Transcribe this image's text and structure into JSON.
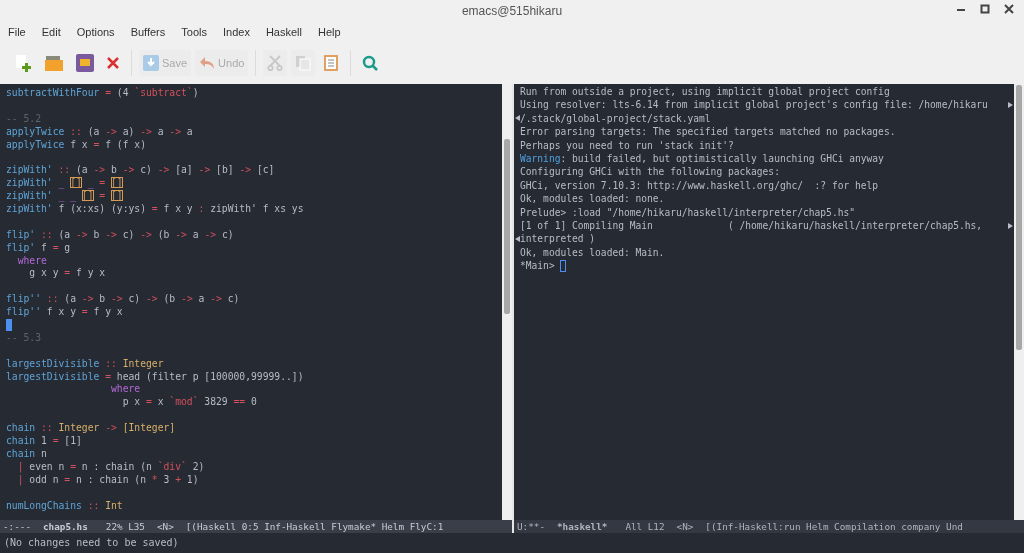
{
  "window": {
    "title": "emacs@515hikaru"
  },
  "menu": [
    "File",
    "Edit",
    "Options",
    "Buffers",
    "Tools",
    "Index",
    "Haskell",
    "Help"
  ],
  "toolbar": [
    {
      "disabled": false
    },
    {
      "disabled": false
    },
    {
      "disabled": false
    },
    {
      "disabled": false
    },
    {
      "label": "Save",
      "disabled": true
    },
    {
      "label": "Undo",
      "disabled": true
    },
    {
      "disabled": true
    },
    {
      "disabled": true
    },
    {
      "disabled": false
    },
    {
      "disabled": false
    }
  ],
  "editor": {
    "lines": [
      {
        "kind": "code",
        "tokens": [
          {
            "kind": "fn",
            "text": "subtractWithFour"
          },
          {
            "kind": "op",
            "text": " = "
          },
          {
            "kind": "plain",
            "text": "(4 "
          },
          {
            "kind": "op",
            "text": "`subtract`"
          },
          {
            "kind": "plain",
            "text": ")"
          }
        ]
      },
      {
        "kind": "blank"
      },
      {
        "kind": "code",
        "tokens": [
          {
            "kind": "comment",
            "text": "-- 5.2"
          }
        ]
      },
      {
        "kind": "code",
        "tokens": [
          {
            "kind": "fn",
            "text": "applyTwice"
          },
          {
            "kind": "op",
            "text": " :: "
          },
          {
            "kind": "plain",
            "text": "(a "
          },
          {
            "kind": "op",
            "text": "->"
          },
          {
            "kind": "plain",
            "text": " a) "
          },
          {
            "kind": "op",
            "text": "->"
          },
          {
            "kind": "plain",
            "text": " a "
          },
          {
            "kind": "op",
            "text": "->"
          },
          {
            "kind": "plain",
            "text": " a"
          }
        ]
      },
      {
        "kind": "code",
        "tokens": [
          {
            "kind": "fn",
            "text": "applyTwice"
          },
          {
            "kind": "plain",
            "text": " f x "
          },
          {
            "kind": "op",
            "text": "="
          },
          {
            "kind": "plain",
            "text": " f (f x)"
          }
        ]
      },
      {
        "kind": "blank"
      },
      {
        "kind": "code",
        "tokens": [
          {
            "kind": "fn",
            "text": "zipWith'"
          },
          {
            "kind": "op",
            "text": " :: "
          },
          {
            "kind": "plain",
            "text": "(a "
          },
          {
            "kind": "op",
            "text": "->"
          },
          {
            "kind": "plain",
            "text": " b "
          },
          {
            "kind": "op",
            "text": "->"
          },
          {
            "kind": "plain",
            "text": " c) "
          },
          {
            "kind": "op",
            "text": "->"
          },
          {
            "kind": "plain",
            "text": " [a] "
          },
          {
            "kind": "op",
            "text": "->"
          },
          {
            "kind": "plain",
            "text": " [b] "
          },
          {
            "kind": "op",
            "text": "->"
          },
          {
            "kind": "plain",
            "text": " [c]"
          }
        ]
      },
      {
        "kind": "code",
        "tokens": [
          {
            "kind": "fn",
            "text": "zipWith'"
          },
          {
            "kind": "wild",
            "text": " _ "
          },
          {
            "kind": "bracket",
            "text": "[]"
          },
          {
            "kind": "wild",
            "text": " _"
          },
          {
            "kind": "op",
            "text": " = "
          },
          {
            "kind": "bracket",
            "text": "[]"
          }
        ]
      },
      {
        "kind": "code",
        "tokens": [
          {
            "kind": "fn",
            "text": "zipWith'"
          },
          {
            "kind": "wild",
            "text": " _ _ "
          },
          {
            "kind": "bracket",
            "text": "[]"
          },
          {
            "kind": "op",
            "text": " = "
          },
          {
            "kind": "bracket",
            "text": "[]"
          }
        ]
      },
      {
        "kind": "code",
        "tokens": [
          {
            "kind": "fn",
            "text": "zipWith'"
          },
          {
            "kind": "plain",
            "text": " f (x:xs) (y:ys) "
          },
          {
            "kind": "op",
            "text": "="
          },
          {
            "kind": "plain",
            "text": " f x y "
          },
          {
            "kind": "op",
            "text": ":"
          },
          {
            "kind": "plain",
            "text": " zipWith' f xs ys"
          }
        ]
      },
      {
        "kind": "blank"
      },
      {
        "kind": "code",
        "tokens": [
          {
            "kind": "fn",
            "text": "flip'"
          },
          {
            "kind": "op",
            "text": " :: "
          },
          {
            "kind": "plain",
            "text": "(a "
          },
          {
            "kind": "op",
            "text": "->"
          },
          {
            "kind": "plain",
            "text": " b "
          },
          {
            "kind": "op",
            "text": "->"
          },
          {
            "kind": "plain",
            "text": " c) "
          },
          {
            "kind": "op",
            "text": "->"
          },
          {
            "kind": "plain",
            "text": " (b "
          },
          {
            "kind": "op",
            "text": "->"
          },
          {
            "kind": "plain",
            "text": " a "
          },
          {
            "kind": "op",
            "text": "->"
          },
          {
            "kind": "plain",
            "text": " c)"
          }
        ]
      },
      {
        "kind": "code",
        "tokens": [
          {
            "kind": "fn",
            "text": "flip'"
          },
          {
            "kind": "plain",
            "text": " f "
          },
          {
            "kind": "op",
            "text": "="
          },
          {
            "kind": "plain",
            "text": " g"
          }
        ]
      },
      {
        "kind": "code",
        "tokens": [
          {
            "kind": "kw",
            "text": "  where"
          }
        ]
      },
      {
        "kind": "code",
        "tokens": [
          {
            "kind": "plain",
            "text": "    g x y "
          },
          {
            "kind": "op",
            "text": "="
          },
          {
            "kind": "plain",
            "text": " f y x"
          }
        ]
      },
      {
        "kind": "blank"
      },
      {
        "kind": "code",
        "tokens": [
          {
            "kind": "fn",
            "text": "flip''"
          },
          {
            "kind": "op",
            "text": " :: "
          },
          {
            "kind": "plain",
            "text": "(a "
          },
          {
            "kind": "op",
            "text": "->"
          },
          {
            "kind": "plain",
            "text": " b "
          },
          {
            "kind": "op",
            "text": "->"
          },
          {
            "kind": "plain",
            "text": " c) "
          },
          {
            "kind": "op",
            "text": "->"
          },
          {
            "kind": "plain",
            "text": " (b "
          },
          {
            "kind": "op",
            "text": "->"
          },
          {
            "kind": "plain",
            "text": " a "
          },
          {
            "kind": "op",
            "text": "->"
          },
          {
            "kind": "plain",
            "text": " c)"
          }
        ]
      },
      {
        "kind": "code",
        "tokens": [
          {
            "kind": "fn",
            "text": "flip''"
          },
          {
            "kind": "plain",
            "text": " f x y "
          },
          {
            "kind": "op",
            "text": "="
          },
          {
            "kind": "plain",
            "text": " f y x"
          }
        ]
      },
      {
        "kind": "cursor"
      },
      {
        "kind": "code",
        "tokens": [
          {
            "kind": "comment",
            "text": "-- 5.3"
          }
        ]
      },
      {
        "kind": "blank"
      },
      {
        "kind": "code",
        "tokens": [
          {
            "kind": "fn",
            "text": "largestDivisible"
          },
          {
            "kind": "op",
            "text": " :: "
          },
          {
            "kind": "type",
            "text": "Integer"
          }
        ]
      },
      {
        "kind": "code",
        "tokens": [
          {
            "kind": "fn",
            "text": "largestDivisible"
          },
          {
            "kind": "op",
            "text": " = "
          },
          {
            "kind": "plain",
            "text": "head (filter p [100000,99999..])"
          }
        ]
      },
      {
        "kind": "code",
        "tokens": [
          {
            "kind": "kw",
            "text": "                  where"
          }
        ]
      },
      {
        "kind": "code",
        "tokens": [
          {
            "kind": "plain",
            "text": "                    p x "
          },
          {
            "kind": "op",
            "text": "="
          },
          {
            "kind": "plain",
            "text": " x "
          },
          {
            "kind": "op",
            "text": "`mod`"
          },
          {
            "kind": "plain",
            "text": " 3829 "
          },
          {
            "kind": "op",
            "text": "=="
          },
          {
            "kind": "plain",
            "text": " 0"
          }
        ]
      },
      {
        "kind": "blank"
      },
      {
        "kind": "code",
        "tokens": [
          {
            "kind": "fn",
            "text": "chain"
          },
          {
            "kind": "op",
            "text": " :: "
          },
          {
            "kind": "type",
            "text": "Integer"
          },
          {
            "kind": "op",
            "text": " -> "
          },
          {
            "kind": "type",
            "text": "[Integer]"
          }
        ]
      },
      {
        "kind": "code",
        "tokens": [
          {
            "kind": "fn",
            "text": "chain"
          },
          {
            "kind": "plain",
            "text": " 1 "
          },
          {
            "kind": "op",
            "text": "="
          },
          {
            "kind": "plain",
            "text": " [1]"
          }
        ]
      },
      {
        "kind": "code",
        "tokens": [
          {
            "kind": "fn",
            "text": "chain"
          },
          {
            "kind": "plain",
            "text": " n"
          }
        ]
      },
      {
        "kind": "code",
        "tokens": [
          {
            "kind": "op",
            "text": "  |"
          },
          {
            "kind": "plain",
            "text": " even n "
          },
          {
            "kind": "op",
            "text": "="
          },
          {
            "kind": "plain",
            "text": " n : chain (n "
          },
          {
            "kind": "op",
            "text": "`div`"
          },
          {
            "kind": "plain",
            "text": " 2)"
          }
        ]
      },
      {
        "kind": "code",
        "tokens": [
          {
            "kind": "op",
            "text": "  |"
          },
          {
            "kind": "plain",
            "text": " odd n "
          },
          {
            "kind": "op",
            "text": "="
          },
          {
            "kind": "plain",
            "text": " n : chain (n "
          },
          {
            "kind": "op",
            "text": "*"
          },
          {
            "kind": "plain",
            "text": " 3 "
          },
          {
            "kind": "op",
            "text": "+"
          },
          {
            "kind": "plain",
            "text": " 1)"
          }
        ]
      },
      {
        "kind": "blank"
      },
      {
        "kind": "code",
        "tokens": [
          {
            "kind": "fn",
            "text": "numLongChains"
          },
          {
            "kind": "op",
            "text": " :: "
          },
          {
            "kind": "type",
            "text": "Int"
          }
        ]
      }
    ],
    "mode_line": {
      "state": "-:---",
      "buffer": "chap5.hs",
      "position": "22% L35",
      "evil": "<N>",
      "modes": "[(Haskell 0:5 Inf-Haskell Flymake* Helm FlyC:1"
    }
  },
  "repl": {
    "lines": [
      {
        "tokens": [
          {
            "kind": "plain",
            "text": "Run from outside a project, using implicit global project config"
          }
        ]
      },
      {
        "wraps": true,
        "tokens": [
          {
            "kind": "plain",
            "text": "Using resolver: lts-6.14 from implicit global project's config file: /home/hikaru"
          }
        ]
      },
      {
        "continued": true,
        "tokens": [
          {
            "kind": "plain",
            "text": "/.stack/global-project/stack.yaml"
          }
        ]
      },
      {
        "tokens": [
          {
            "kind": "plain",
            "text": "Error parsing targets: The specified targets matched no packages."
          }
        ]
      },
      {
        "tokens": [
          {
            "kind": "plain",
            "text": "Perhaps you need to run 'stack init'?"
          }
        ]
      },
      {
        "tokens": [
          {
            "kind": "warn",
            "text": "Warning"
          },
          {
            "kind": "plain",
            "text": ": build failed, but optimistically launching GHCi anyway"
          }
        ]
      },
      {
        "tokens": [
          {
            "kind": "plain",
            "text": "Configuring GHCi with the following packages:"
          }
        ]
      },
      {
        "tokens": [
          {
            "kind": "plain",
            "text": "GHCi, version 7.10.3: http://www.haskell.org/ghc/  :? for help"
          }
        ]
      },
      {
        "tokens": [
          {
            "kind": "plain",
            "text": "Ok, modules loaded: none."
          }
        ]
      },
      {
        "tokens": [
          {
            "kind": "plain",
            "text": "Prelude> :load \"/home/hikaru/haskell/interpreter/chap5.hs\""
          }
        ]
      },
      {
        "wraps": true,
        "tokens": [
          {
            "kind": "plain",
            "text": "[1 of 1] Compiling Main             ( /home/hikaru/haskell/interpreter/chap5.hs,"
          }
        ]
      },
      {
        "continued": true,
        "tokens": [
          {
            "kind": "plain",
            "text": "interpreted )"
          }
        ]
      },
      {
        "tokens": [
          {
            "kind": "plain",
            "text": "Ok, modules loaded: Main."
          }
        ]
      },
      {
        "cursor": true,
        "tokens": [
          {
            "kind": "plain",
            "text": "*Main> "
          }
        ]
      }
    ],
    "mode_line": {
      "state": "U:**-",
      "buffer": "*haskell*",
      "position": "All L12",
      "evil": "<N>",
      "modes": "[(Inf-Haskell:run Helm Compilation company Und"
    }
  },
  "echo_area": "(No changes need to be saved)"
}
